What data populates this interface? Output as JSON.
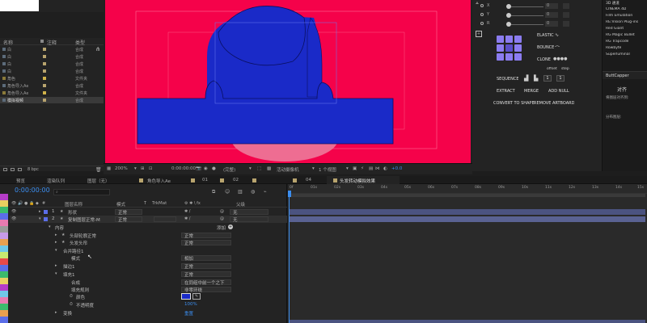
{
  "project": {
    "col_name": "名称",
    "col_label": "注释",
    "col_type": "类型",
    "items": [
      {
        "name": "白",
        "type": "合成",
        "color": "#b8a46e"
      },
      {
        "name": "白",
        "type": "合成",
        "color": "#b8a46e"
      },
      {
        "name": "白",
        "type": "合成",
        "color": "#b8a46e"
      },
      {
        "name": "白",
        "type": "合成",
        "color": "#b8a46e"
      },
      {
        "name": "角色",
        "type": "文件夹",
        "color": "#d0b24a"
      },
      {
        "name": "角色导入Ae",
        "type": "合成",
        "color": "#b8a46e"
      },
      {
        "name": "角色导入Ae",
        "type": "文件夹",
        "color": "#d0b24a"
      },
      {
        "name": "模拟视频",
        "type": "合成",
        "color": "#b8a46e"
      }
    ],
    "bpc": "8 bpc"
  },
  "viewer": {
    "zoom": "200%",
    "timecode": "0:00:00:00",
    "resolution": "(完整)",
    "camera": "活动摄像机",
    "views": "1 个视图",
    "offset": "+0.0"
  },
  "effects_panel": {
    "row_values": [
      "0",
      "0",
      "0"
    ],
    "elastic": "ELASTIC",
    "bounce": "BOUNCE",
    "clone": "CLONE",
    "offset": "offset",
    "step": "step",
    "sequence": "SEQUENCE",
    "seq_value": "1",
    "extract": "EXTRACT",
    "merge": "MERGE",
    "add_null": "ADD NULL",
    "convert_to_shape": "CONVERT TO SHAPE",
    "remove_artboard": "REMOVE ARTBOARD",
    "accent_color": "#8b7cf0"
  },
  "plugins": {
    "items": [
      "3D 通道",
      "CINEMA 4D",
      "Film Emulation",
      "RE:Vision Plug-ins",
      "Red Giant",
      "RG Magic Bullet",
      "RG Trapcode",
      "Rowbyte",
      "Superluminal"
    ],
    "panel_title": "ButtCapper",
    "align_label": "对齐",
    "align_to": "将图层对齐到:",
    "distribute": "分布图层:"
  },
  "timeline_tabs": {
    "preview": "预览",
    "render_queue": "渲染队列",
    "layer": "图层（无）",
    "comp": "角色导入Ae",
    "tab1": "01",
    "tab2": "02",
    "tab3": "04",
    "active_tab": "头发转动模拟效果"
  },
  "timeline": {
    "timecode": "0:00:00:00",
    "col_layer_name": "图层名称",
    "col_mode": "模式",
    "col_t": "T",
    "col_trkmat": "TrkMat",
    "col_parent": "父级",
    "ruler": [
      "0f",
      "01s",
      "02s",
      "03s",
      "04s",
      "05s",
      "06s",
      "07s",
      "08s",
      "09s",
      "10s",
      "11s",
      "12s",
      "13s",
      "14s",
      "15s"
    ],
    "layers": [
      {
        "num": "1",
        "name": "形状",
        "mode": "正常",
        "parent": "无",
        "color": "#5b6ee8"
      },
      {
        "num": "2",
        "name": "复制图层正常-M",
        "mode": "正常",
        "parent": "无",
        "color": "#5b6ee8"
      }
    ],
    "props": [
      {
        "name": "内容",
        "value": "添加"
      },
      {
        "name": "头部轮廓正常",
        "value": "正常"
      },
      {
        "name": "头发头帘",
        "value": "正常"
      },
      {
        "name": "合并路径1",
        "value": ""
      },
      {
        "name": "模式",
        "value": "相加"
      },
      {
        "name": "描边1",
        "value": "正常"
      },
      {
        "name": "填充1",
        "value": "正常"
      },
      {
        "name": "合成",
        "value": "在同组中前一个之下"
      },
      {
        "name": "填充规则",
        "value": "非零环绕"
      },
      {
        "name": "颜色",
        "value": ""
      },
      {
        "name": "不透明度",
        "value": "100%"
      },
      {
        "name": "变换",
        "value": "重置"
      }
    ]
  }
}
